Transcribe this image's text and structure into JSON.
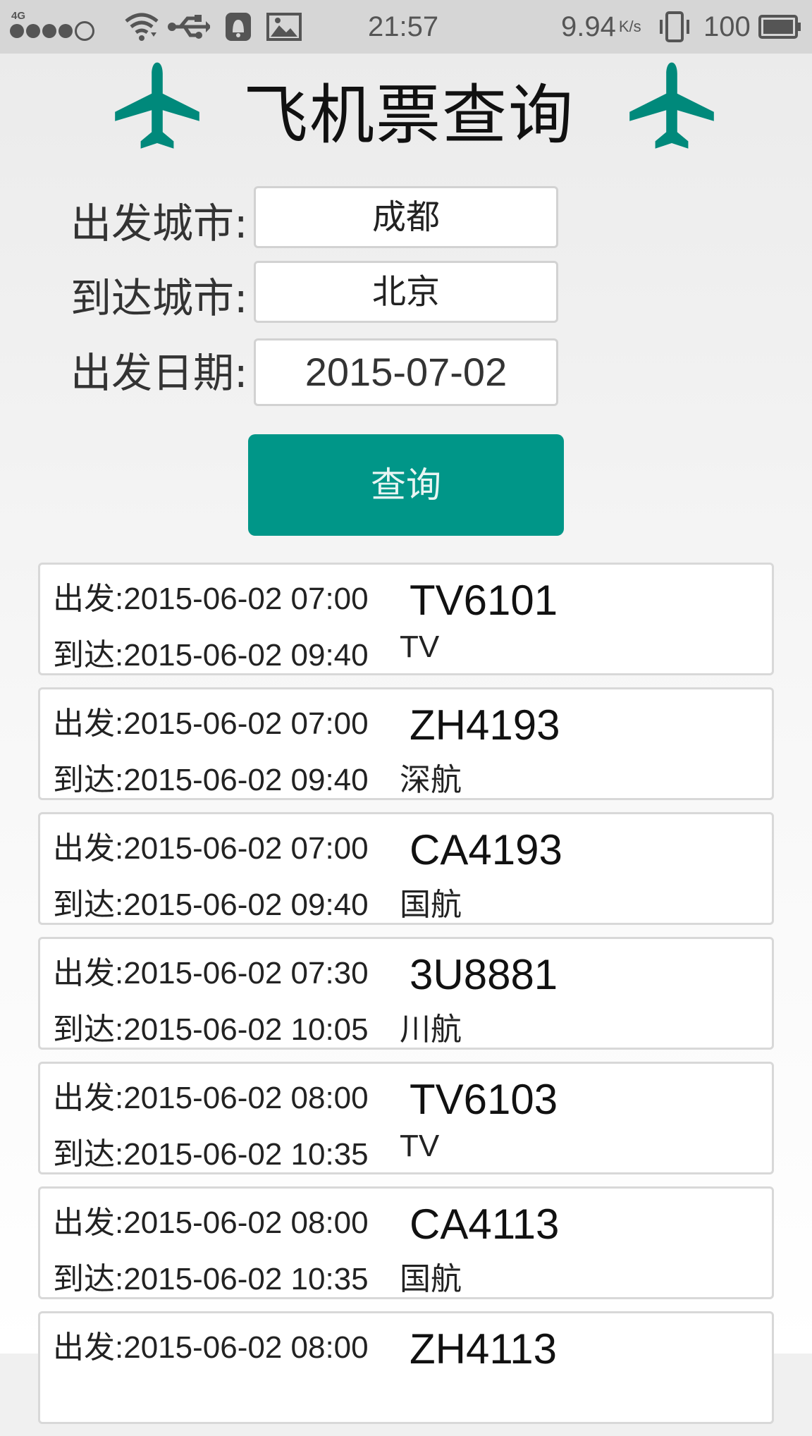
{
  "status_bar": {
    "network": "4G",
    "time": "21:57",
    "speed": "9.94",
    "speed_unit": "K/s",
    "battery": "100",
    "icons": [
      "signal-icon",
      "wifi-icon",
      "usb-icon",
      "notification-icon",
      "gallery-icon",
      "vibrate-icon",
      "battery-icon"
    ]
  },
  "header": {
    "title": "飞机票查询",
    "icon": "airplane-icon",
    "accent_color": "#00897B"
  },
  "form": {
    "from_label": "出发城市:",
    "from_value": "成都",
    "to_label": "到达城市:",
    "to_value": "北京",
    "date_label": "出发日期:",
    "date_value": "2015-07-02"
  },
  "search_button": {
    "label": "查询",
    "color": "#009688"
  },
  "flights": [
    {
      "departure": "出发:2015-06-02 07:00",
      "arrival": "到达:2015-06-02 09:40",
      "flight_no": "TV6101",
      "airline": "TV"
    },
    {
      "departure": "出发:2015-06-02 07:00",
      "arrival": "到达:2015-06-02 09:40",
      "flight_no": "ZH4193",
      "airline": "深航"
    },
    {
      "departure": "出发:2015-06-02 07:00",
      "arrival": "到达:2015-06-02 09:40",
      "flight_no": "CA4193",
      "airline": "国航"
    },
    {
      "departure": "出发:2015-06-02 07:30",
      "arrival": "到达:2015-06-02 10:05",
      "flight_no": "3U8881",
      "airline": "川航"
    },
    {
      "departure": "出发:2015-06-02 08:00",
      "arrival": "到达:2015-06-02 10:35",
      "flight_no": "TV6103",
      "airline": "TV"
    },
    {
      "departure": "出发:2015-06-02 08:00",
      "arrival": "到达:2015-06-02 10:35",
      "flight_no": "CA4113",
      "airline": "国航"
    },
    {
      "departure": "出发:2015-06-02 08:00",
      "arrival": "",
      "flight_no": "ZH4113",
      "airline": ""
    }
  ]
}
